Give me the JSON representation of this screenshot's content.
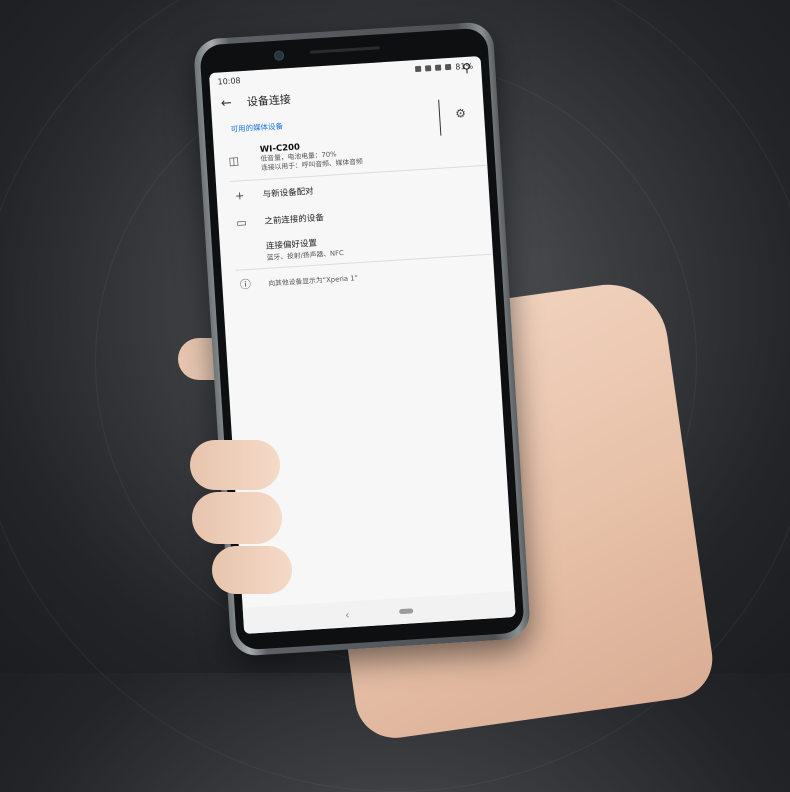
{
  "status_bar": {
    "time": "10:08",
    "battery": "81%"
  },
  "app_bar": {
    "title": "设备连接"
  },
  "sections": {
    "available_media_title": "可用的媒体设备",
    "device": {
      "name": "WI-C200",
      "line1": "低音量，电池电量：70%",
      "line2": "连接以用于：呼叫音频、媒体音频"
    },
    "pair_new": "与新设备配对",
    "previously_connected": "之前连接的设备",
    "prefs_title": "连接偏好设置",
    "prefs_sub": "蓝牙、投射/扬声器、NFC",
    "visible_as": "向其他设备显示为“Xperia 1”"
  },
  "icons": {
    "search": "search-icon",
    "back": "arrow-left-icon",
    "gear": "gear-icon",
    "headset": "headset-icon",
    "plus": "plus-icon",
    "devices": "devices-icon",
    "info": "info-icon"
  }
}
